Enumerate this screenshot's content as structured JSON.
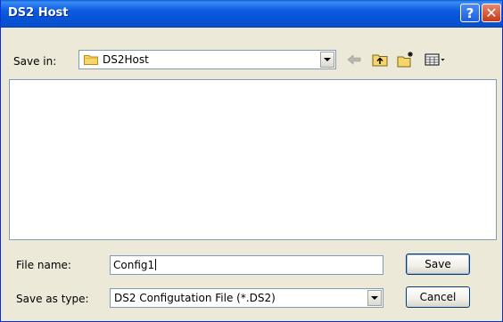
{
  "window": {
    "title": "DS2 Host",
    "help_glyph": "?",
    "close_glyph": "✕"
  },
  "save_in": {
    "label": "Save in:",
    "value": "DS2Host"
  },
  "toolbar": {
    "icons": [
      "back-arrow-icon",
      "up-one-level-icon",
      "create-new-folder-icon",
      "view-menu-icon"
    ]
  },
  "file_name": {
    "label": "File name:",
    "value": "Config1"
  },
  "save_as_type": {
    "label": "Save as type:",
    "value": "DS2 Configutation File (*.DS2)"
  },
  "buttons": {
    "save": "Save",
    "cancel": "Cancel"
  }
}
